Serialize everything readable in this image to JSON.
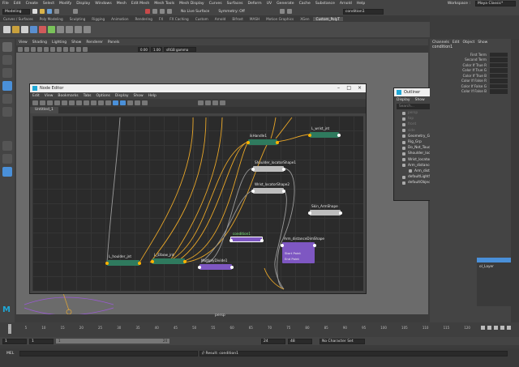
{
  "menubar": {
    "items": [
      "File",
      "Edit",
      "Create",
      "Select",
      "Modify",
      "Display",
      "Windows",
      "Mesh",
      "Edit Mesh",
      "Mesh Tools",
      "Mesh Display",
      "Curves",
      "Surfaces",
      "Deform",
      "UV",
      "Generate",
      "Cache",
      "Substance",
      "Arnold",
      "Help"
    ],
    "workspace_label": "Workspace :",
    "workspace_value": "Maya Classic*"
  },
  "status": {
    "mode": "Modeling",
    "live_surface": "No Live Surface",
    "symmetry": "Symmetry: Off",
    "object_field": "condition1"
  },
  "shelf_tabs": [
    "Curves / Surfaces",
    "Poly Modeling",
    "Sculpting",
    "Rigging",
    "Animation",
    "Rendering",
    "FX",
    "FX Caching",
    "Custom",
    "Arnold",
    "Bifrost",
    "MASH",
    "Motion Graphics",
    "XGen",
    "Custom_PolyT"
  ],
  "shelf_active_tab": "Custom_PolyT",
  "viewport": {
    "menu": [
      "View",
      "Shading",
      "Lighting",
      "Show",
      "Renderer",
      "Panels"
    ],
    "gamma": "sRGB gamma",
    "val1": "0.00",
    "val2": "1.00",
    "camera": "persp"
  },
  "node_editor": {
    "title": "Node Editor",
    "menu": [
      "Edit",
      "View",
      "Bookmarks",
      "Tabs",
      "Options",
      "Display",
      "Show",
      "Help"
    ],
    "tab": "Untitled_1",
    "nodes": [
      {
        "key": "lshoulder",
        "label": "L_houlder_jnt"
      },
      {
        "key": "lelbow",
        "label": "L_Elbow_jnt"
      },
      {
        "key": "ikhandle",
        "label": "ikHandle1"
      },
      {
        "key": "lwrist",
        "label": "L_wrist_jnt"
      },
      {
        "key": "shoulder_loc",
        "label": "Shoulder_locatorShape1"
      },
      {
        "key": "wrist_loc",
        "label": "Wrist_locatorShape2"
      },
      {
        "key": "skin",
        "label": "Skin_ArmShape"
      },
      {
        "key": "condition",
        "label": "condition1"
      },
      {
        "key": "distance",
        "label": "Arm_distanceDimShape"
      },
      {
        "key": "multiply",
        "label": "MultiplyDivide1"
      }
    ],
    "distance_ports": [
      "Start Point",
      "End Point"
    ]
  },
  "outliner": {
    "title": "Outliner",
    "menu": [
      "Display",
      "Show",
      "Help"
    ],
    "search_placeholder": "Search...",
    "items": [
      {
        "label": "persp",
        "dim": true,
        "indent": 0
      },
      {
        "label": "top",
        "dim": true,
        "indent": 0
      },
      {
        "label": "front",
        "dim": true,
        "indent": 0
      },
      {
        "label": "side",
        "dim": true,
        "indent": 0
      },
      {
        "label": "Geometry_Grp",
        "dim": false,
        "indent": 0
      },
      {
        "label": "Rig_Grp",
        "dim": false,
        "indent": 0
      },
      {
        "label": "Do_Not_Touch",
        "dim": false,
        "indent": 0
      },
      {
        "label": "Shoulder_locator1",
        "dim": false,
        "indent": 0
      },
      {
        "label": "Wrist_locator2",
        "dim": false,
        "indent": 0
      },
      {
        "label": "Arm_distanceDim",
        "dim": false,
        "indent": 0
      },
      {
        "label": "Arm_distanceDimShape",
        "dim": false,
        "indent": 1
      },
      {
        "label": "defaultLightSet",
        "dim": false,
        "indent": 0
      },
      {
        "label": "defaultObjectSet",
        "dim": false,
        "indent": 0
      }
    ]
  },
  "channel_box": {
    "menu": [
      "Channels",
      "Edit",
      "Object",
      "Show"
    ],
    "node": "condition1",
    "rows": [
      "First Term",
      "Second Term",
      "Color If True R",
      "Color If True G",
      "Color If True B",
      "Color If False R",
      "Color If False G",
      "Color If False B"
    ],
    "layer_label": "ol_Layer"
  },
  "timeline": {
    "ticks": [
      "1",
      "5",
      "10",
      "15",
      "20",
      "25",
      "30",
      "35",
      "40",
      "45",
      "50",
      "55",
      "60",
      "65",
      "70",
      "75",
      "80",
      "85",
      "90",
      "95",
      "100",
      "105",
      "110",
      "115",
      "120"
    ],
    "current_frame": "1"
  },
  "range": {
    "start": "1",
    "start2": "1",
    "slider_end": "24",
    "end": "24",
    "end2": "48",
    "character_set": "No Character Set"
  },
  "command": {
    "label": "MEL",
    "result": "// Result: condition1"
  }
}
